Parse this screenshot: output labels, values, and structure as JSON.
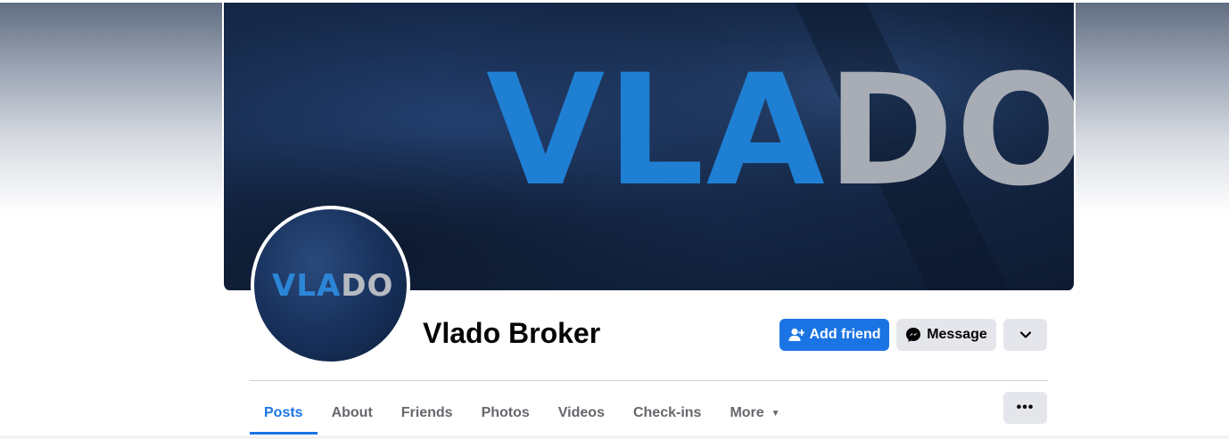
{
  "cover": {
    "logo_blue": "VLA",
    "logo_gray": "DO"
  },
  "avatar": {
    "logo_blue": "VLA",
    "logo_gray": "DO"
  },
  "profile": {
    "name": "Vlado Broker"
  },
  "actions": {
    "add_friend": "Add friend",
    "message": "Message",
    "dropdown_icon": "chevron-down-icon"
  },
  "tabs": [
    {
      "label": "Posts",
      "active": true
    },
    {
      "label": "About"
    },
    {
      "label": "Friends"
    },
    {
      "label": "Photos"
    },
    {
      "label": "Videos"
    },
    {
      "label": "Check-ins"
    },
    {
      "label": "More"
    }
  ],
  "more_menu": {
    "label": "•••"
  },
  "colors": {
    "accent": "#1b74e4",
    "cover_bg": "#16294a",
    "logo_blue": "#1f7fd3",
    "logo_gray": "#a8adb5"
  }
}
